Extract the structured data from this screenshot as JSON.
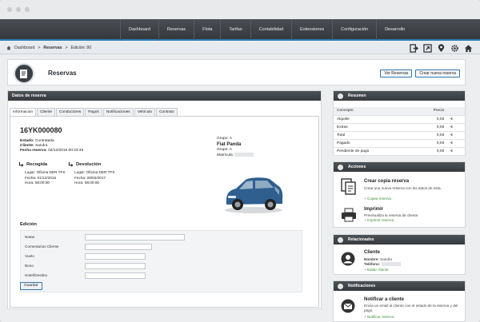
{
  "nav": {
    "items": [
      "Dashboard",
      "Reservas",
      "Flota",
      "Tarifas",
      "Contabilidad",
      "Extensiones",
      "Configuración",
      "Desarrollo"
    ]
  },
  "breadcrumb": {
    "home": "Dashboard",
    "section": "Reservas",
    "current": "Edición: 80"
  },
  "toolbar_icons": [
    "logout-icon",
    "export-icon",
    "location-icon",
    "settings-icon",
    "home-icon"
  ],
  "page": {
    "title": "Reservas",
    "btn_list": "Ver Reservas",
    "btn_new": "Crear nueva reserva"
  },
  "main": {
    "panel_title": "Datos de reserva",
    "tabs": [
      "Informacion",
      "Cliente",
      "Conductores",
      "Pagos",
      "Notificaciones",
      "Vehículo",
      "Contrato"
    ],
    "active_tab": 0,
    "reservation_id": "16YK000080",
    "estado_label": "Estado:",
    "estado": "Contratada",
    "cliente_label": "Cliente:",
    "cliente": "Sandra",
    "fecha_label": "Fecha reserva:",
    "fecha": "02/12/2016 00:23:45",
    "grupo_label": "Grupo:",
    "grupo": "A",
    "car_name": "Fiat Panda",
    "grupo2_label": "Grupo:",
    "grupo2": "A",
    "matricula_label": "Matrícula:",
    "pickup": {
      "title": "Recogida",
      "lugar_label": "Lugar:",
      "lugar": "Oficina DER TFS",
      "fecha_label": "Fecha:",
      "fecha": "01/12/2016",
      "hora_label": "Hora:",
      "hora": "08:00:00"
    },
    "return": {
      "title": "Devolución",
      "lugar_label": "Lugar:",
      "lugar": "Oficina DER TFS",
      "fecha_label": "Fecha:",
      "fecha": "28/02/2017",
      "hora_label": "Hora:",
      "hora": "08:00:00"
    },
    "edit": {
      "title": "Edición",
      "fields": [
        "Notas",
        "Comentarios Cliente",
        "Vuelo",
        "Bono",
        "Hotel/Destino"
      ],
      "save": "Guardar"
    }
  },
  "resumen": {
    "title": "Resumen",
    "col_concept": "Concepto",
    "col_price": "Precio",
    "rows": [
      {
        "concept": "Alquiler",
        "price": "0,00",
        "cur": "€"
      },
      {
        "concept": "Extras",
        "price": "0,00",
        "cur": "€"
      },
      {
        "concept": "Total",
        "price": "0,00",
        "cur": "€"
      },
      {
        "concept": "Pagado",
        "price": "0,00",
        "cur": "€"
      },
      {
        "concept": "Pendiente de pago",
        "price": "0,00",
        "cur": "€"
      }
    ]
  },
  "acciones": {
    "title": "Acciones",
    "copy_title": "Crear copia reserva",
    "copy_desc": "Crear una nueva reserva con los datos de esta.",
    "copy_link": "Copiar reserva",
    "print_title": "Imprimir",
    "print_desc": "Previsualiza la reserva de cliente.",
    "print_link": "Imprimir reserva"
  },
  "relacionados": {
    "title": "Relacionados",
    "client_title": "Cliente",
    "nombre_label": "Nombre:",
    "nombre": "Sandra",
    "telefono_label": "Teléfono:",
    "edit_link": "Editar cliente"
  },
  "notificaciones": {
    "title": "Notificaciones",
    "notify_title": "Notificar a cliente",
    "notify_desc": "Envía un email al cliente con el estado de la reserva y del pago.",
    "notify_link": "Notificar reserva"
  },
  "colors": {
    "accent": "#2a7fb8",
    "header": "#3b3f44",
    "link_green": "#3a8f3a"
  }
}
